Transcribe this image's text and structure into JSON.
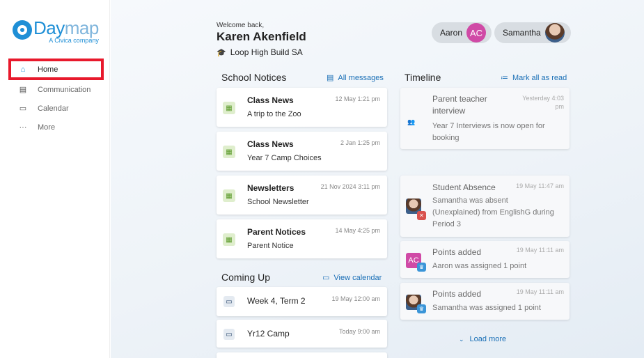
{
  "sidebar": {
    "logo": {
      "name_a": "Day",
      "name_b": "map",
      "sub": "A Civica company"
    },
    "items": [
      {
        "label": "Home",
        "icon": "home-icon",
        "glyph": "⌂"
      },
      {
        "label": "Communication",
        "icon": "message-icon",
        "glyph": "▤"
      },
      {
        "label": "Calendar",
        "icon": "calendar-icon",
        "glyph": "▭"
      },
      {
        "label": "More",
        "icon": "more-icon",
        "glyph": "···"
      }
    ]
  },
  "header": {
    "welcome": "Welcome back,",
    "name": "Karen Akenfield",
    "school": "Loop High Build SA",
    "students": [
      {
        "name": "Aaron",
        "initials": "AC"
      },
      {
        "name": "Samantha",
        "initials": ""
      }
    ]
  },
  "notices": {
    "title": "School Notices",
    "link": "All messages",
    "items": [
      {
        "title": "Class News",
        "subtitle": "A trip to the Zoo",
        "date": "12 May 1:21 pm"
      },
      {
        "title": "Class News",
        "subtitle": "Year 7 Camp Choices",
        "date": "2 Jan 1:25 pm"
      },
      {
        "title": "Newsletters",
        "subtitle": "School Newsletter",
        "date": "21 Nov 2024 3:11 pm"
      },
      {
        "title": "Parent Notices",
        "subtitle": "Parent Notice",
        "date": "14 May 4:25 pm"
      }
    ]
  },
  "coming_up": {
    "title": "Coming Up",
    "link": "View calendar",
    "items": [
      {
        "title": "Week 4, Term 2",
        "date": "19 May 12:00 am"
      },
      {
        "title": "Yr12 Camp",
        "date": "Today 9:00 am"
      }
    ]
  },
  "timeline": {
    "title": "Timeline",
    "link": "Mark all as read",
    "items": [
      {
        "title": "Parent teacher interview",
        "title_l1": "Parent teacher",
        "title_l2": "interview",
        "date_l1": "Yesterday 4:03",
        "date_l2": "pm",
        "body_l1": "Year 7 Interviews is now open for",
        "body_l2": "booking"
      },
      {
        "title": "Student Absence",
        "date": "19 May 11:47 am",
        "body_l1": "Samantha was absent",
        "body_l2": "(Unexplained) from EnglishG during",
        "body_l3": "Period 3"
      },
      {
        "title": "Points added",
        "date": "19 May 11:11 am",
        "body": "Aaron was assigned 1 point",
        "avatar": "AC"
      },
      {
        "title": "Points added",
        "date": "19 May 11:11 am",
        "body": "Samantha was assigned 1 point"
      }
    ],
    "load_more": "Load more"
  },
  "colors": {
    "accent": "#1f8fd6",
    "link": "#1a6fb6",
    "highlight": "#e8192c",
    "avatar_ac": "#d04aa6"
  }
}
